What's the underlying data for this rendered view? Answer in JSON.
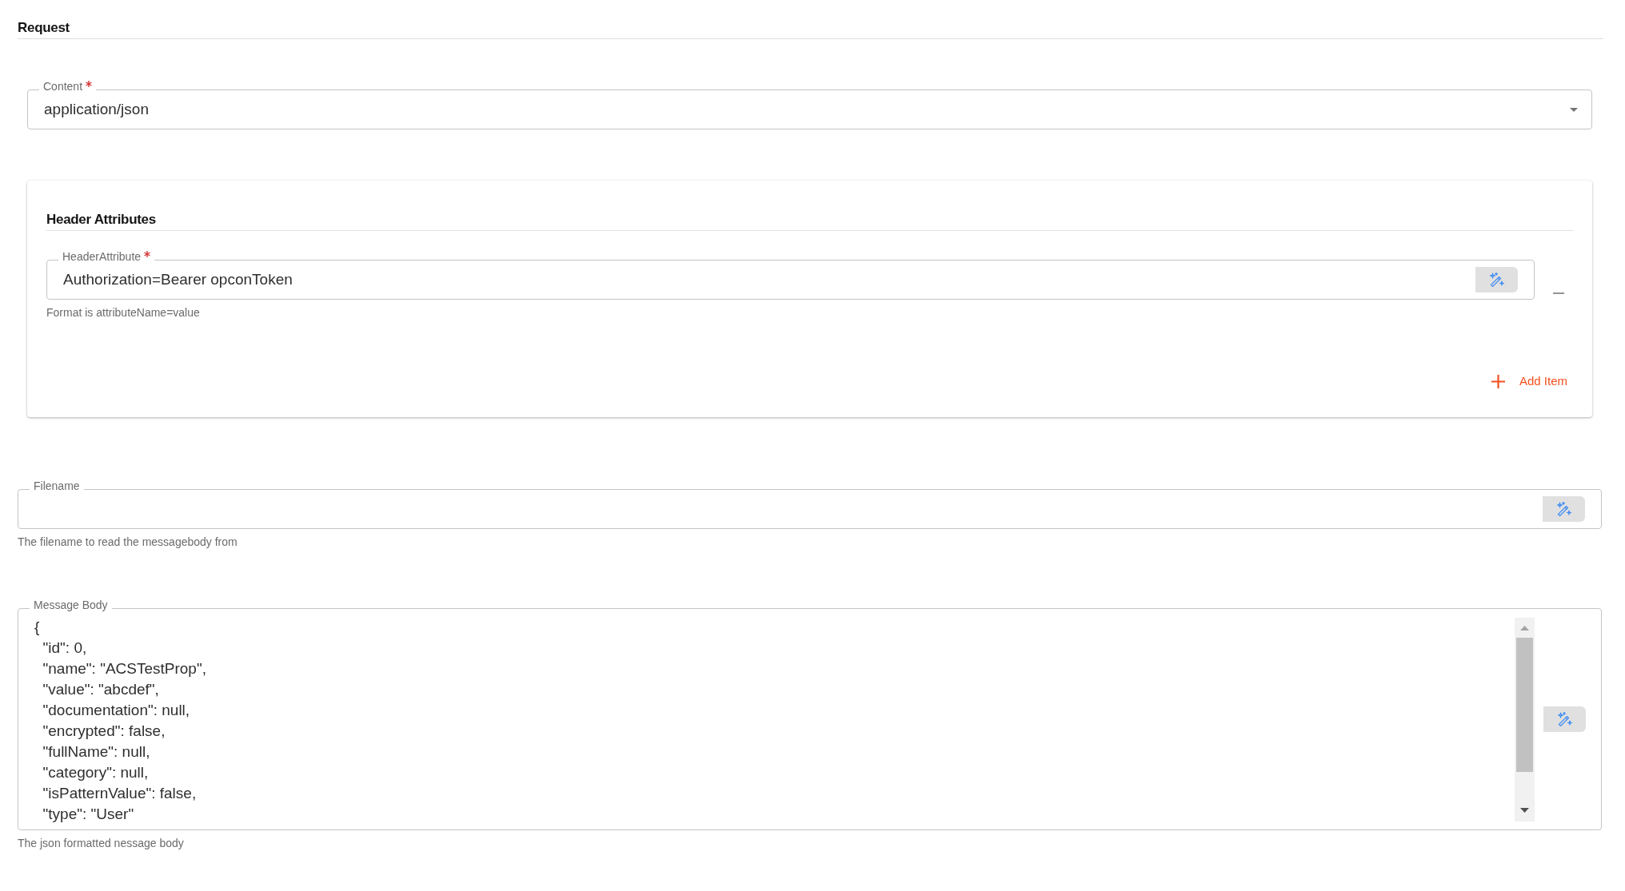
{
  "request": {
    "title": "Request",
    "content": {
      "label": "Content",
      "required": true,
      "value": "application/json"
    },
    "header_attributes": {
      "title": "Header Attributes",
      "items": [
        {
          "label": "HeaderAttribute",
          "required": true,
          "value": "Authorization=Bearer opconToken",
          "hint": "Format is attributeName=value"
        }
      ],
      "add_label": "Add Item"
    },
    "filename": {
      "label": "Filename",
      "hint": "The filename to read the messagebody from"
    },
    "message_body": {
      "label": "Message Body",
      "lines": [
        "{",
        "  \"id\": 0,",
        "  \"name\": \"ACSTestProp\",",
        "  \"value\": \"abcdef\",",
        "  \"documentation\": null,",
        "  \"encrypted\": false,",
        "  \"fullName\": null,",
        "  \"category\": null,",
        "  \"isPatternValue\": false,",
        "  \"type\": \"User\""
      ],
      "hint": "The json formatted nessage body"
    }
  }
}
